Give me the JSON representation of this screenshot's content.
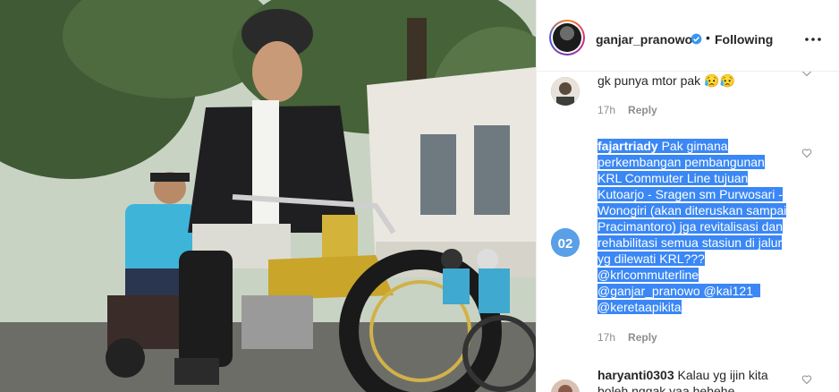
{
  "post_header": {
    "username": "ganjar_pranowo",
    "separator": "•",
    "follow_status": "Following"
  },
  "comments": [
    {
      "text": "gk punya mtor pak 😥😥",
      "time": "17h",
      "reply_label": "Reply"
    },
    {
      "username": "fajartriady",
      "text_lines": [
        "Pak gimana",
        "perkembangan pembangunan",
        "KRL Commuter Line tujuan",
        "Kutoarjo - Sragen sm Purwosari -",
        "Wonogiri (akan diteruskan sampai",
        "Pracimantoro) jga revitalisasi dan",
        "rehabilitasi semua stasiun di jalur",
        "yg dilewati KRL???",
        "@krlcommuterline",
        "@ganjar_pranowo @kai121_",
        "@keretaapikita"
      ],
      "avatar_label": "02",
      "time": "17h",
      "reply_label": "Reply"
    },
    {
      "username": "haryanti0303",
      "text_line1": "Kalau yg ijin kita",
      "text_line2": "boleh nggak yaa hehehe"
    }
  ],
  "colors": {
    "verified": "#3897f0",
    "selection": "#3a87f5",
    "avatar02": "#5aa0e6"
  },
  "icons": [
    "verified-badge-icon",
    "more-options-icon",
    "heart-icon"
  ]
}
